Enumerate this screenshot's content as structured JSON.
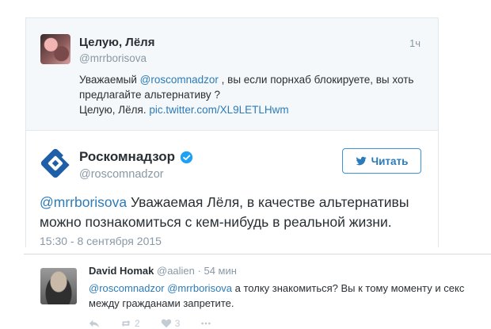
{
  "quoted_tweet": {
    "name": "Целую, Лёля",
    "handle": "@mrrborisova",
    "time": "1ч",
    "text_prefix": "Уважаемый ",
    "mention": "@roscomnadzor",
    "text_suffix": " , вы если порнхаб блокируете, вы хоть предлагайте альтернативу ?",
    "sign_off": "Целую, Лёля. ",
    "link": "pic.twitter.com/XL9LETLHwm"
  },
  "main_tweet": {
    "name": "Роскомнадзор",
    "handle": "@roscomnadzor",
    "follow_label": "Читать",
    "mention": "@mrrborisova",
    "text": " Уважаемая Лёля, в качестве альтернативы можно познакомиться с кем-нибудь в реальной жизни.",
    "date": "15:30 - 8 сентября 2015"
  },
  "reply": {
    "name": "David Homak",
    "handle": "@aalien",
    "separator": " · ",
    "time": "54 мин",
    "mention1": "@roscomnadzor",
    "mention2": "@mrrborisova",
    "text": " а толку знакомиться? Вы к тому моменту и секс между гражданами запретите.",
    "actions": {
      "retweets": "2",
      "likes": "3"
    }
  },
  "colors": {
    "link": "#2b7bb9",
    "muted": "#8899a6",
    "verified": "#1da1f2",
    "logo": "#1f5fa8"
  },
  "icons": [
    "verified-badge-icon",
    "twitter-bird-icon",
    "rkn-logo-icon",
    "reply-icon",
    "retweet-icon",
    "like-icon",
    "more-icon"
  ]
}
